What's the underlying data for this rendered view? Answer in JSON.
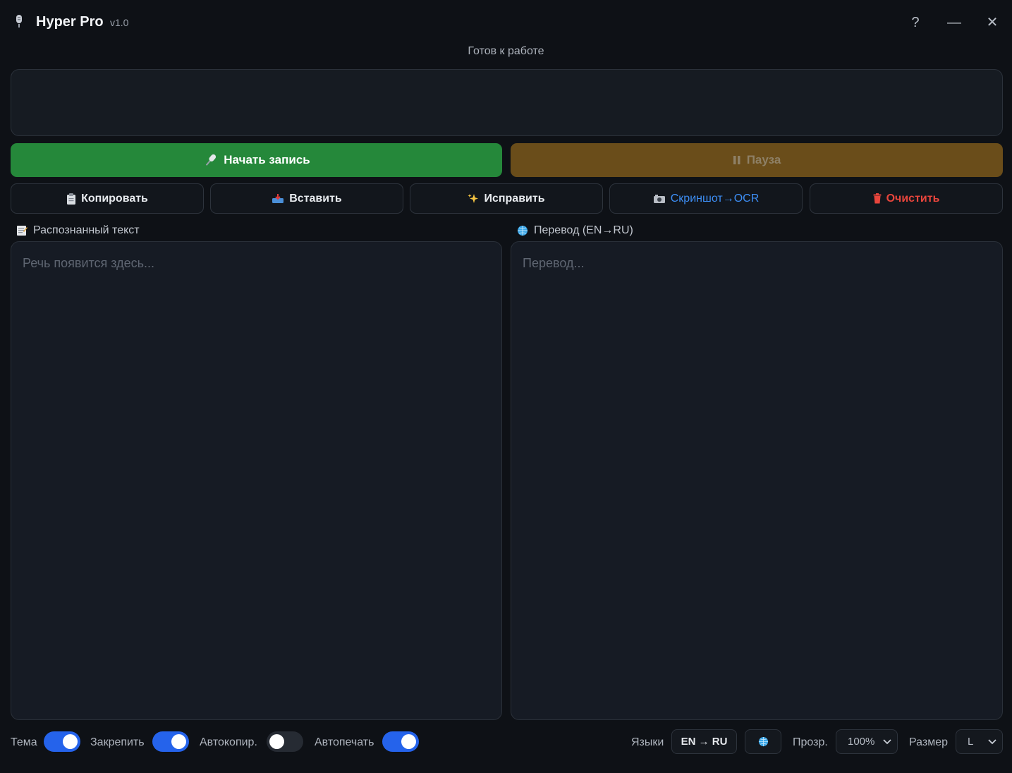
{
  "window": {
    "title": "Hyper Pro",
    "version": "v1.0",
    "help_label": "?",
    "minimize_label": "—",
    "close_label": "✕"
  },
  "status": "Готов к работе",
  "controls": {
    "record_label": "Начать запись",
    "pause_label": "Пауза"
  },
  "actions": {
    "copy_label": "Копировать",
    "paste_label": "Вставить",
    "fix_label": "Исправить",
    "ocr_label": "Скриншот→OCR",
    "clear_label": "Очистить"
  },
  "panels": {
    "recognized": {
      "label": "Распознанный текст",
      "placeholder": "Речь появится здесь..."
    },
    "translation": {
      "label": "Перевод (EN→RU)",
      "placeholder": "Перевод..."
    }
  },
  "bottom": {
    "theme_label": "Тема",
    "theme_on": true,
    "pin_label": "Закрепить",
    "pin_on": true,
    "autocopy_label": "Автокопир.",
    "autocopy_on": false,
    "autoprint_label": "Автопечать",
    "autoprint_on": true,
    "languages_label": "Языки",
    "language_pair": "EN → RU",
    "opacity_label": "Прозр.",
    "opacity_value": "100%",
    "size_label": "Размер",
    "size_value": "L"
  },
  "colors": {
    "record": "#25883a",
    "pause": "#6a4d1a",
    "toggle_on": "#2563eb",
    "ocr_text": "#3d8ef5",
    "clear_text": "#e8453c"
  }
}
